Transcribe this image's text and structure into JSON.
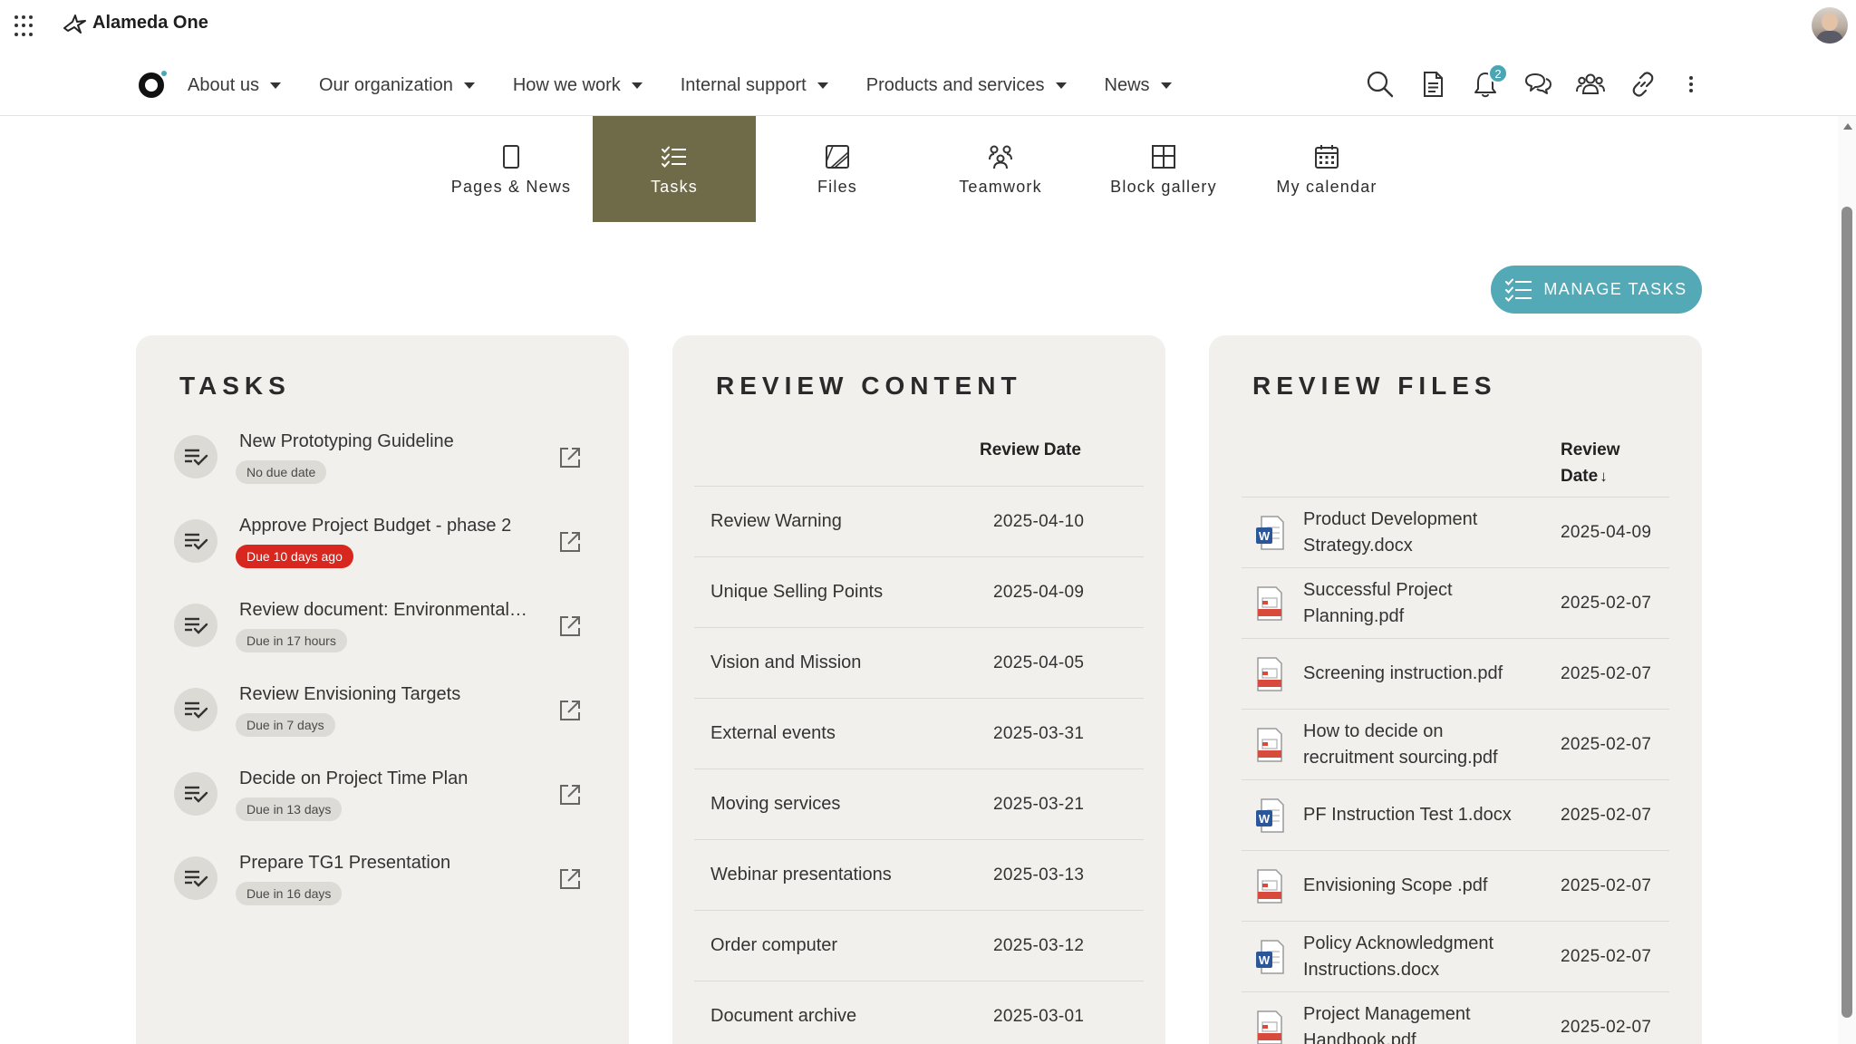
{
  "app": {
    "name": "Alameda One"
  },
  "colors": {
    "accent": "#54a9b7",
    "active_tab": "#6f6a47",
    "overdue": "#d7271e",
    "card_bg": "#f1f0ed"
  },
  "nav": {
    "items": [
      {
        "label": "About us"
      },
      {
        "label": "Our organization"
      },
      {
        "label": "How we work"
      },
      {
        "label": "Internal support"
      },
      {
        "label": "Products and services"
      },
      {
        "label": "News"
      }
    ],
    "notifications_count": "2",
    "icons": [
      "search-icon",
      "document-icon",
      "bell-icon",
      "chat-icon",
      "people-icon",
      "link-icon",
      "more-icon"
    ]
  },
  "subtabs": [
    {
      "label": "Pages & News",
      "icon": "page-icon"
    },
    {
      "label": "Tasks",
      "icon": "task-list-icon",
      "active": true
    },
    {
      "label": "Files",
      "icon": "files-icon"
    },
    {
      "label": "Teamwork",
      "icon": "teamwork-icon"
    },
    {
      "label": "Block gallery",
      "icon": "block-gallery-icon"
    },
    {
      "label": "My calendar",
      "icon": "calendar-icon"
    }
  ],
  "manage_tasks": {
    "label": "MANAGE TASKS"
  },
  "tasks": {
    "title": "TASKS",
    "items": [
      {
        "title": "New Prototyping Guideline",
        "due": "No due date",
        "overdue": false
      },
      {
        "title": "Approve Project Budget - phase 2",
        "due": "Due 10 days ago",
        "overdue": true
      },
      {
        "title": "Review document: Environmental ...",
        "due": "Due in 17 hours",
        "overdue": false
      },
      {
        "title": "Review Envisioning Targets",
        "due": "Due in 7 days",
        "overdue": false
      },
      {
        "title": "Decide on Project Time Plan",
        "due": "Due in 13 days",
        "overdue": false
      },
      {
        "title": "Prepare TG1 Presentation",
        "due": "Due in 16 days",
        "overdue": false
      }
    ]
  },
  "review_content": {
    "title": "REVIEW CONTENT",
    "date_header": "Review Date",
    "rows": [
      {
        "name": "Review Warning",
        "date": "2025-04-10"
      },
      {
        "name": "Unique Selling Points",
        "date": "2025-04-09"
      },
      {
        "name": "Vision and Mission",
        "date": "2025-04-05"
      },
      {
        "name": "External events",
        "date": "2025-03-31"
      },
      {
        "name": "Moving services",
        "date": "2025-03-21"
      },
      {
        "name": "Webinar presentations",
        "date": "2025-03-13"
      },
      {
        "name": "Order computer",
        "date": "2025-03-12"
      },
      {
        "name": "Document archive",
        "date": "2025-03-01"
      }
    ]
  },
  "review_files": {
    "title": "REVIEW FILES",
    "date_header_1": "Review",
    "date_header_2": "Date",
    "sort_indicator": "↓",
    "rows": [
      {
        "name_1": "Product Development",
        "name_2": "Strategy.docx",
        "type": "docx",
        "date": "2025-04-09"
      },
      {
        "name_1": "Successful Project",
        "name_2": "Planning.pdf",
        "type": "pdf",
        "date": "2025-02-07"
      },
      {
        "name_1": "Screening instruction.pdf",
        "name_2": "",
        "type": "pdf",
        "date": "2025-02-07"
      },
      {
        "name_1": "How to decide on",
        "name_2": "recruitment sourcing.pdf",
        "type": "pdf",
        "date": "2025-02-07"
      },
      {
        "name_1": "PF Instruction Test 1.docx",
        "name_2": "",
        "type": "docx",
        "date": "2025-02-07"
      },
      {
        "name_1": "Envisioning Scope .pdf",
        "name_2": "",
        "type": "pdf",
        "date": "2025-02-07"
      },
      {
        "name_1": "Policy Acknowledgment",
        "name_2": "Instructions.docx",
        "type": "docx",
        "date": "2025-02-07"
      },
      {
        "name_1": "Project Management",
        "name_2": "Handbook.pdf",
        "type": "pdf",
        "date": "2025-02-07"
      }
    ]
  }
}
